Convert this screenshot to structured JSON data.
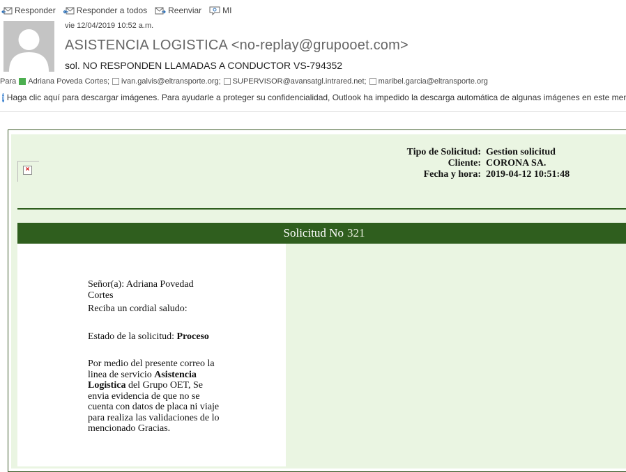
{
  "toolbar": {
    "reply": "Responder",
    "reply_all": "Responder a todos",
    "forward": "Reenviar",
    "im": "MI"
  },
  "header": {
    "date": "vie 12/04/2019 10:52 a.m.",
    "sender": "ASISTENCIA LOGISTICA <no-replay@grupooet.com>",
    "subject": "sol. NO RESPONDEN LLAMADAS A CONDUCTOR VS-794352",
    "to_label": "Para",
    "recipients": [
      "Adriana Poveda Cortes;",
      "ivan.galvis@eltransporte.org;",
      "SUPERVISOR@avansatgl.intrared.net;",
      "maribel.garcia@eltransporte.org"
    ]
  },
  "infobar": {
    "text": "Haga clic aquí para descargar imágenes. Para ayudarle a proteger su confidencialidad, Outlook ha impedido la descarga automática de algunas imágenes en este mensaje."
  },
  "message": {
    "meta_labels": [
      "Tipo de Solicitud:",
      "Cliente:",
      "Fecha y hora:"
    ],
    "meta_values": [
      "Gestion solicitud",
      "CORONA SA.",
      "2019-04-12 10:51:48"
    ],
    "banner_label": "Solicitud No",
    "banner_number": "321",
    "greeting_1": "Señor(a): Adriana Povedad Cortes",
    "greeting_2": "Reciba un cordial saludo:",
    "status_label": "Estado de la solicitud:",
    "status_value": "Proceso",
    "p1": "Por medio del presente correo la linea de servicio",
    "p_bold": "Asistencia Logistica",
    "p2": "del Grupo OET, Se envia evidencia de que no se cuenta con datos de placa ni viaje para realiza las validaciones de lo mencionado Gracias."
  },
  "colors": {
    "banner_green": "#2f5e1e",
    "panel_bg": "#eaf5e2",
    "info_blue": "#1e6fc8"
  }
}
